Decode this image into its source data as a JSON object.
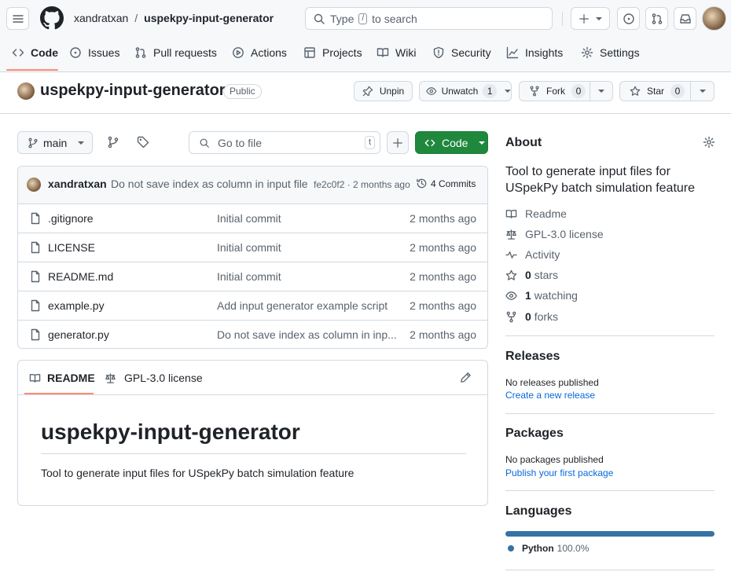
{
  "header": {
    "owner": "xandratxan",
    "repo": "uspekpy-input-generator",
    "search_before": "Type",
    "search_key": "/",
    "search_after": "to search"
  },
  "tabs": [
    {
      "label": "Code",
      "icon": "code-icon"
    },
    {
      "label": "Issues",
      "icon": "issue-icon"
    },
    {
      "label": "Pull requests",
      "icon": "pull-request-icon"
    },
    {
      "label": "Actions",
      "icon": "play-icon"
    },
    {
      "label": "Projects",
      "icon": "table-icon"
    },
    {
      "label": "Wiki",
      "icon": "book-icon"
    },
    {
      "label": "Security",
      "icon": "shield-icon"
    },
    {
      "label": "Insights",
      "icon": "graph-icon"
    },
    {
      "label": "Settings",
      "icon": "gear-icon"
    }
  ],
  "repo_header": {
    "name": "uspekpy-input-generator",
    "visibility": "Public",
    "unpin": "Unpin",
    "unwatch": "Unwatch",
    "watch_count": "1",
    "fork": "Fork",
    "fork_count": "0",
    "star": "Star",
    "star_count": "0"
  },
  "toolbar": {
    "branch": "main",
    "goto_placeholder": "Go to file",
    "goto_key": "t",
    "code_button": "Code"
  },
  "commit": {
    "author": "xandratxan",
    "message": "Do not save index as column in input file",
    "sha_time": "fe2c0f2 · 2 months ago",
    "commits": "4 Commits"
  },
  "files": [
    {
      "name": ".gitignore",
      "message": "Initial commit",
      "time": "2 months ago"
    },
    {
      "name": "LICENSE",
      "message": "Initial commit",
      "time": "2 months ago"
    },
    {
      "name": "README.md",
      "message": "Initial commit",
      "time": "2 months ago"
    },
    {
      "name": "example.py",
      "message": "Add input generator example script",
      "time": "2 months ago"
    },
    {
      "name": "generator.py",
      "message": "Do not save index as column in inp...",
      "time": "2 months ago"
    }
  ],
  "readme": {
    "tab_readme": "README",
    "tab_license": "GPL-3.0 license",
    "title": "uspekpy-input-generator",
    "body": "Tool to generate input files for USpekPy batch simulation feature"
  },
  "about": {
    "heading": "About",
    "description": "Tool to generate input files for USpekPy batch simulation feature",
    "readme": "Readme",
    "license": "GPL-3.0 license",
    "activity": "Activity",
    "stars_count": "0",
    "stars_label": "stars",
    "watching_count": "1",
    "watching_label": "watching",
    "forks_count": "0",
    "forks_label": "forks"
  },
  "releases": {
    "heading": "Releases",
    "none": "No releases published",
    "link": "Create a new release"
  },
  "packages": {
    "heading": "Packages",
    "none": "No packages published",
    "link": "Publish your first package"
  },
  "languages": {
    "heading": "Languages",
    "items": [
      {
        "name": "Python",
        "percent": "100.0%",
        "color": "#3572A5",
        "fraction": 1.0
      }
    ]
  }
}
